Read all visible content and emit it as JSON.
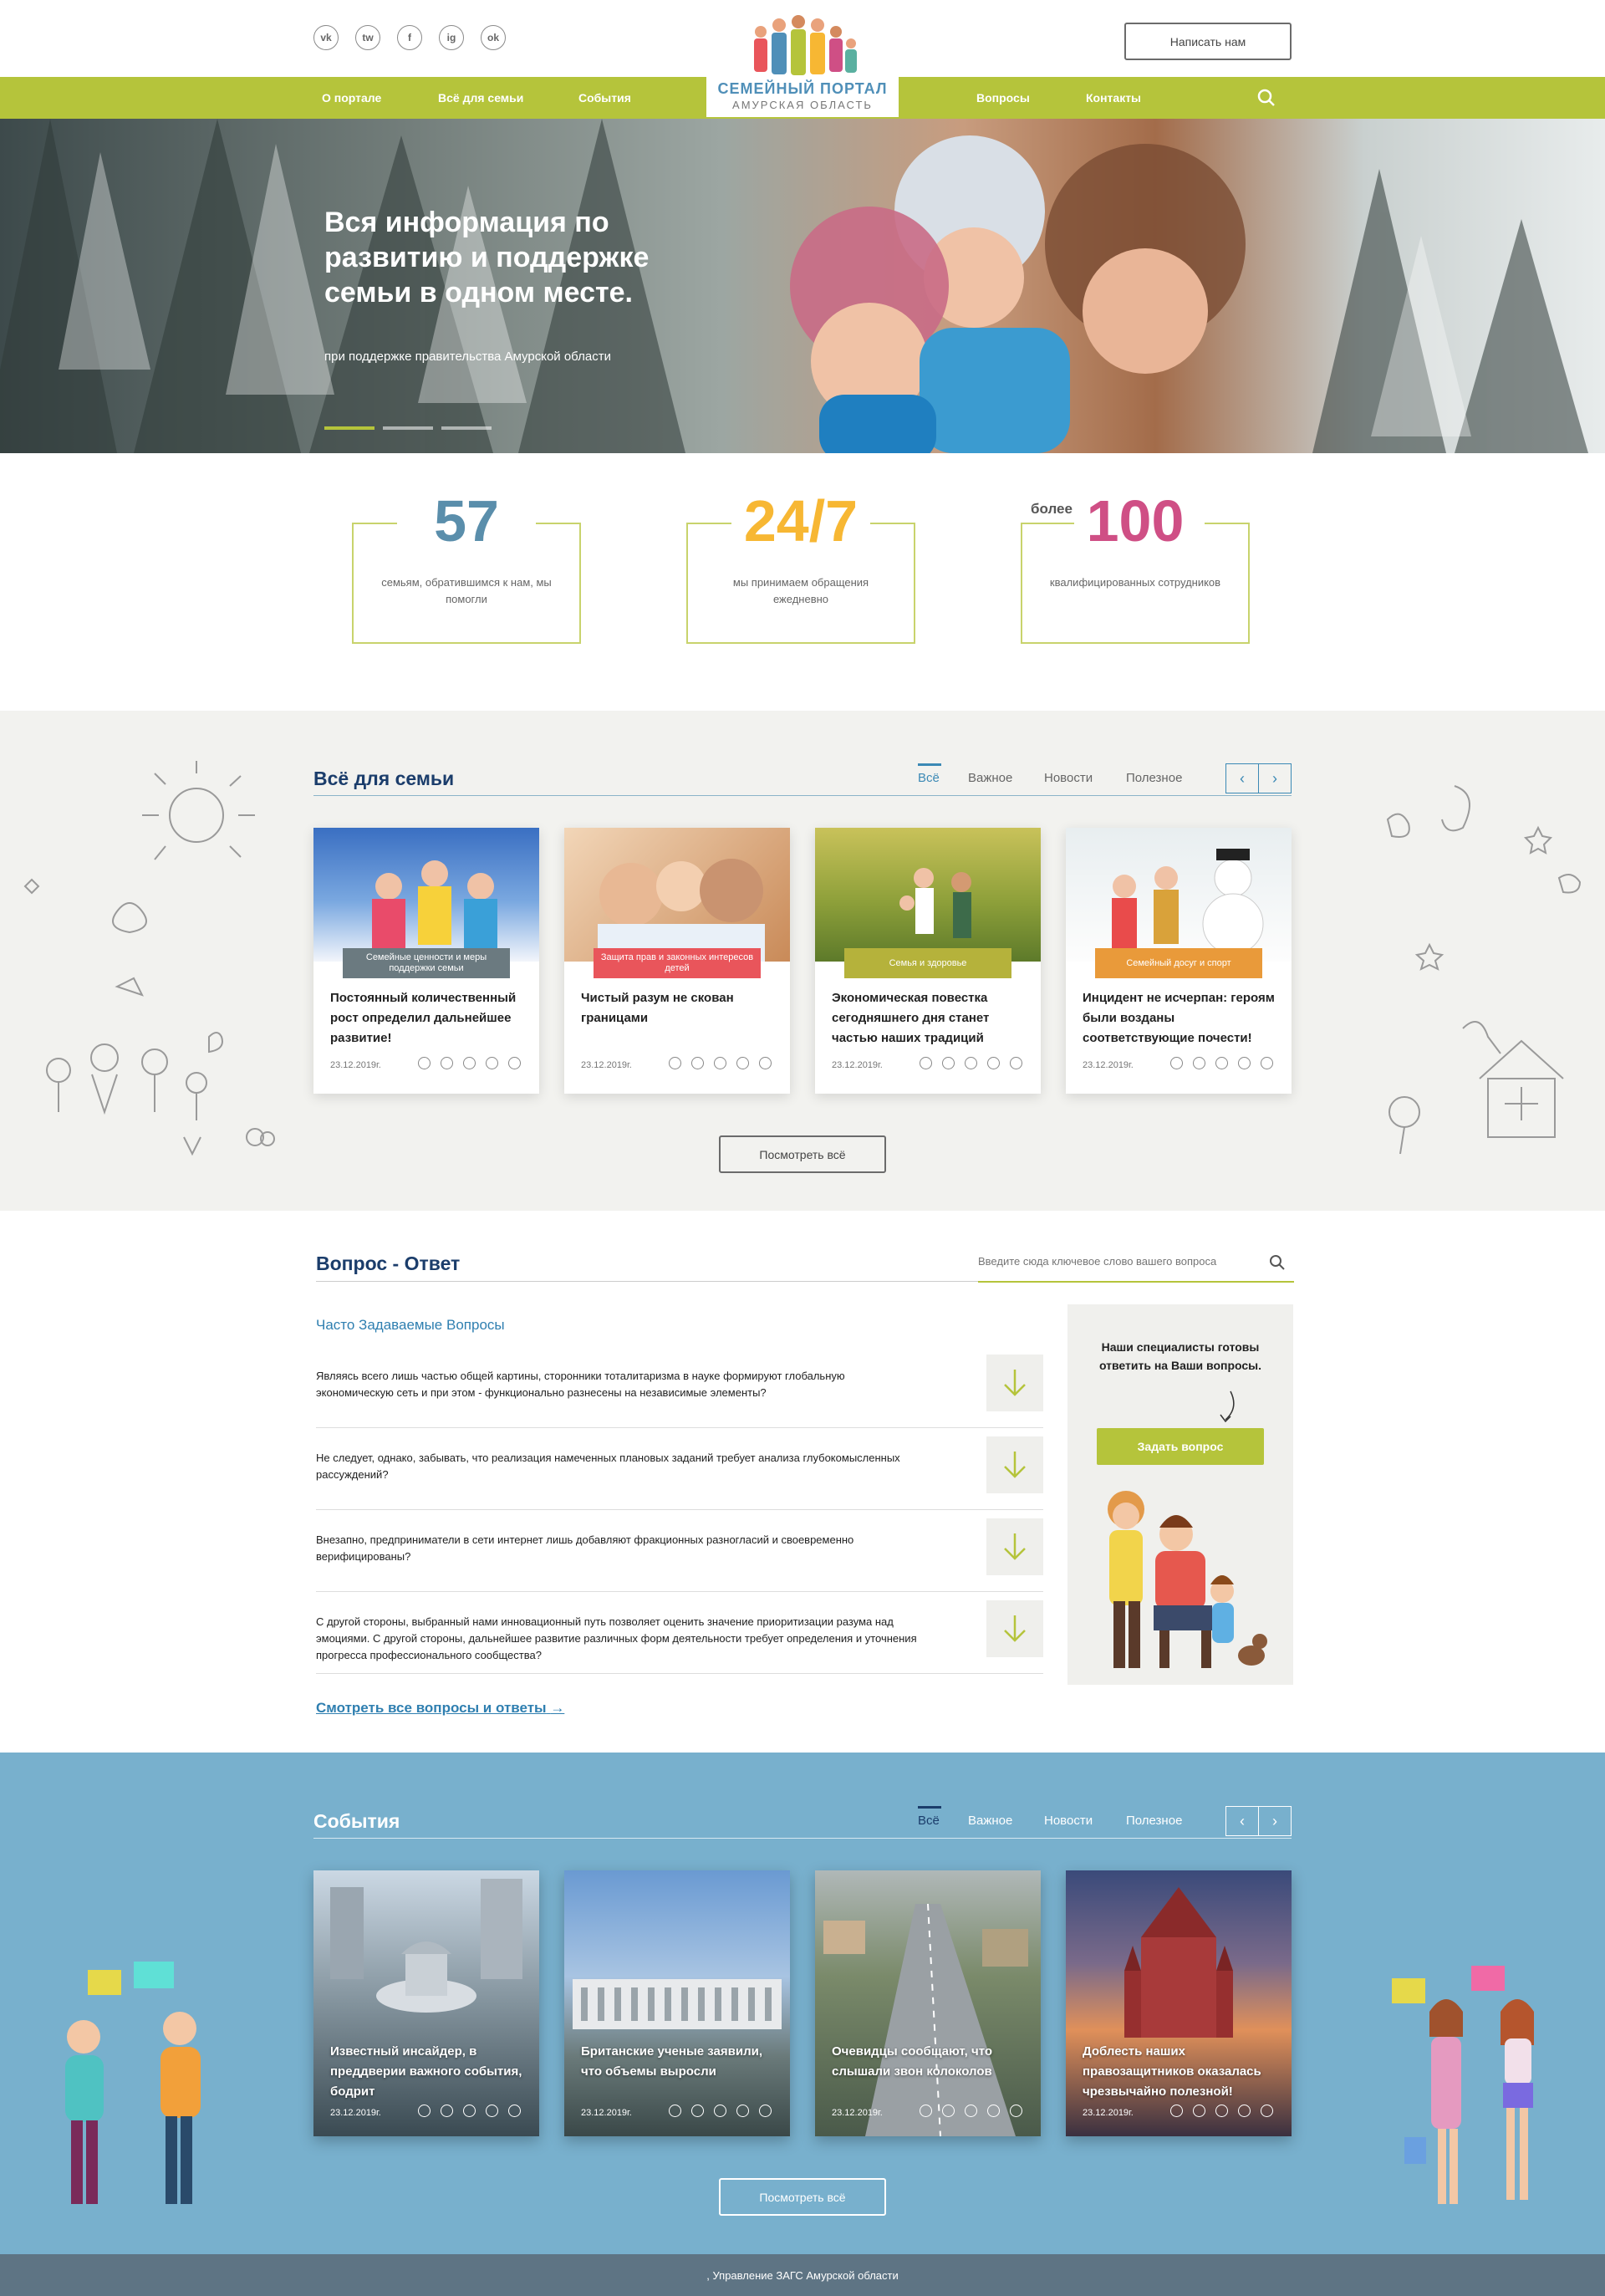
{
  "header": {
    "social": [
      "vk",
      "tw",
      "f",
      "ig",
      "ok"
    ],
    "write_button": "Написать нам",
    "logo_line1": "СЕМЕЙНЫЙ ПОРТАЛ",
    "logo_line2": "АМУРСКАЯ ОБЛАСТЬ",
    "nav": [
      "О портале",
      "Всё для семьи",
      "События",
      "Вопросы",
      "Контакты"
    ],
    "search_icon": "search-icon"
  },
  "hero": {
    "title": "Вся информация по развитию и поддержке семьи в одном месте.",
    "subtitle": "при поддержке правительства Амурской области",
    "slide_count": 3,
    "active_slide": 1
  },
  "stats": [
    {
      "prefix": "",
      "value": "57",
      "text": "семьям, обратившимся к нам, мы помогли",
      "color": "#5a8eab"
    },
    {
      "prefix": "",
      "value": "24/7",
      "text": "мы принимаем обращения ежедневно",
      "color": "#f7b733"
    },
    {
      "prefix": "более",
      "value": "100",
      "text": "квалифицированных сотрудников",
      "color": "#cf4f85"
    }
  ],
  "family": {
    "title": "Всё для семьи",
    "tabs": [
      "Всё",
      "Важное",
      "Новости",
      "Полезное"
    ],
    "cards": [
      {
        "tag": "Семейные ценности и меры поддержки семьи",
        "tag_color": "#6b7a80",
        "title": "Постоянный количественный рост определил дальнейшее развитие!",
        "date": "23.12.2019г."
      },
      {
        "tag": "Защита прав и законных интересов детей",
        "tag_color": "#e9555b",
        "title": "Чистый разум не скован границами",
        "date": "23.12.2019г."
      },
      {
        "tag": "Семья и здоровье",
        "tag_color": "#b5c43b",
        "title": "Экономическая повестка сегодняшнего дня станет частью наших традиций",
        "date": "23.12.2019г."
      },
      {
        "tag": "Семейный досуг и спорт",
        "tag_color": "#e99a3a",
        "title": "Инцидент не исчерпан: героям были возданы соответствующие почести!",
        "date": "23.12.2019г."
      }
    ],
    "see_all": "Посмотреть всё"
  },
  "faq": {
    "title": "Вопрос - Ответ",
    "search_placeholder": "Введите сюда ключевое слово вашего вопроса",
    "subtitle": "Часто Задаваемые Вопросы",
    "questions": [
      "Являясь всего лишь частью общей картины, сторонники тоталитаризма в науке формируют глобальную экономическую сеть и при этом - функционально разнесены на независимые элементы?",
      "Не следует, однако, забывать, что реализация намеченных плановых заданий требует анализа глубокомысленных рассуждений?",
      "Внезапно, предприниматели в сети интернет лишь добавляют фракционных разногласий и своевременно верифицированы?",
      "С другой стороны, выбранный нами инновационный путь позволяет оценить значение приоритизации разума над эмоциями. С другой стороны, дальнейшее развитие различных форм деятельности требует определения и уточнения прогресса профессионального сообщества?"
    ],
    "side_text": "Наши специалисты готовы ответить на Ваши вопросы.",
    "ask_button": "Задать вопрос",
    "all_link": "Смотреть все вопросы и  ответы"
  },
  "events": {
    "title": "События",
    "tabs": [
      "Всё",
      "Важное",
      "Новости",
      "Полезное"
    ],
    "cards": [
      {
        "title": "Известный инсайдер, в преддверии важного события, бодрит",
        "date": "23.12.2019г."
      },
      {
        "title": "Британские ученые заявили, что объемы выросли",
        "date": "23.12.2019г."
      },
      {
        "title": "Очевидцы сообщают, что слышали звон колоколов",
        "date": "23.12.2019г."
      },
      {
        "title": "Доблесть наших правозащитников оказалась чрезвычайно полезной!",
        "date": "23.12.2019г."
      }
    ],
    "see_all": "Посмотреть всё"
  },
  "footer": {
    "text": ", Управление ЗАГС Амурской области"
  }
}
